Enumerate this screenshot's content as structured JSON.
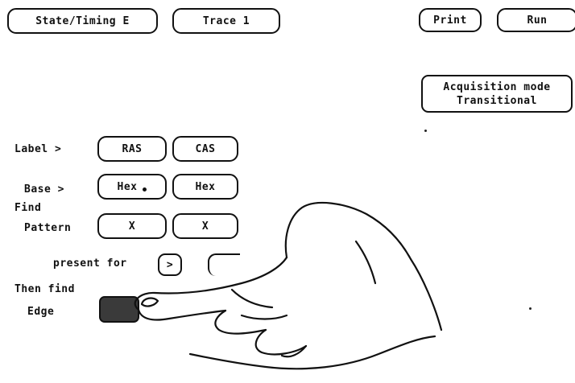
{
  "menu": {
    "mode_button": "State/Timing E",
    "trace_button": "Trace 1",
    "print_button": "Print",
    "run_button": "Run"
  },
  "acquisition": {
    "line1": "Acquisition mode",
    "line2": "Transitional"
  },
  "trace": {
    "label_title": "Label >",
    "label_values": [
      "RAS",
      "CAS"
    ],
    "base_title": "Base >",
    "base_values": [
      "Hex",
      "Hex"
    ],
    "find_title": "Find",
    "pattern_title": "Pattern",
    "pattern_values": [
      "X",
      "X"
    ],
    "present_for_label": "present for",
    "present_for_operator": ">",
    "then_find_label": "Then find",
    "edge_label": "Edge"
  },
  "colors": {
    "ink": "#111111",
    "background": "#ffffff",
    "edge_box_fill": "#3a3a3a"
  }
}
